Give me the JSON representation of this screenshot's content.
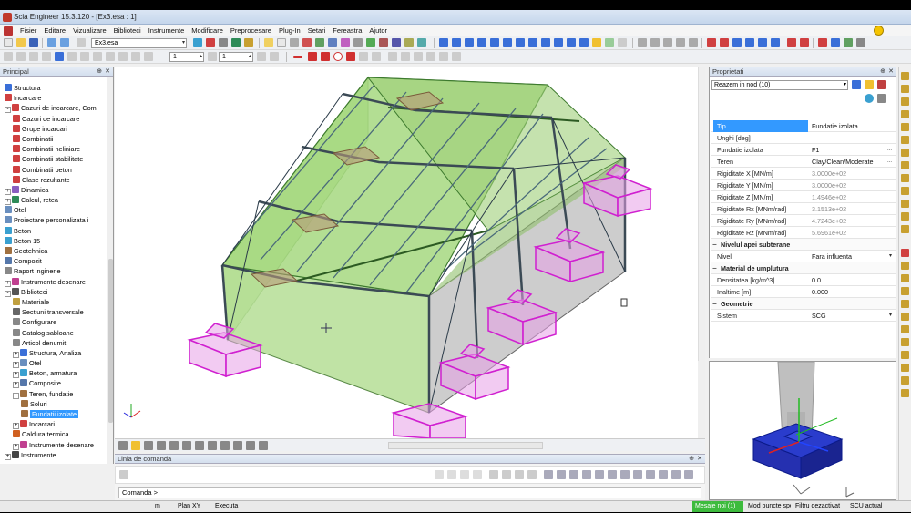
{
  "window": {
    "title": "Scia Engineer 15.3.120 - [Ex3.esa : 1]"
  },
  "menu": [
    "Fisier",
    "Editare",
    "Vizualizare",
    "Biblioteci",
    "Instrumente",
    "Modificare",
    "Preprocesare",
    "Plug-In",
    "Setari",
    "Fereastra",
    "Ajutor"
  ],
  "toolbar": {
    "project_combo": "Ex3.esa",
    "spin1": "1",
    "spin2": "1"
  },
  "left_panel": {
    "title": "Principal",
    "items": [
      {
        "label": "Structura",
        "indent": 1,
        "color": "#3a6fd8"
      },
      {
        "label": "Incarcare",
        "indent": 1,
        "color": "#d04040"
      },
      {
        "label": "Cazuri de incarcare, Com",
        "indent": 1,
        "color": "#d04040",
        "exp": "-"
      },
      {
        "label": "Cazuri de incarcare",
        "indent": 2,
        "color": "#d04040"
      },
      {
        "label": "Grupe incarcari",
        "indent": 2,
        "color": "#d04040"
      },
      {
        "label": "Combinatii",
        "indent": 2,
        "color": "#d04040"
      },
      {
        "label": "Combinatii neliniare",
        "indent": 2,
        "color": "#d04040"
      },
      {
        "label": "Combinatii stabilitate",
        "indent": 2,
        "color": "#d04040"
      },
      {
        "label": "Combinatii beton",
        "indent": 2,
        "color": "#d04040"
      },
      {
        "label": "Clase rezultante",
        "indent": 2,
        "color": "#d04040"
      },
      {
        "label": "Dinamica",
        "indent": 1,
        "color": "#8a5fc0",
        "exp": "+"
      },
      {
        "label": "Calcul, retea",
        "indent": 1,
        "color": "#2e8b57",
        "exp": "+"
      },
      {
        "label": "Otel",
        "indent": 1,
        "color": "#6a8fbf"
      },
      {
        "label": "Proiectare personalizata i",
        "indent": 1,
        "color": "#6a8fbf"
      },
      {
        "label": "Beton",
        "indent": 1,
        "color": "#3aa0d0"
      },
      {
        "label": "Beton 15",
        "indent": 1,
        "color": "#3aa0d0"
      },
      {
        "label": "Geotehnica",
        "indent": 1,
        "color": "#a07040"
      },
      {
        "label": "Compozit",
        "indent": 1,
        "color": "#5577aa"
      },
      {
        "label": "Raport inginerie",
        "indent": 1,
        "color": "#888888"
      },
      {
        "label": "Instrumente desenare",
        "indent": 1,
        "color": "#c04090",
        "exp": "+"
      },
      {
        "label": "Biblioteci",
        "indent": 1,
        "color": "#555555",
        "exp": "-"
      },
      {
        "label": "Materiale",
        "indent": 2,
        "color": "#c0a040"
      },
      {
        "label": "Sectiuni transversale",
        "indent": 2,
        "color": "#666666"
      },
      {
        "label": "Configurare",
        "indent": 2,
        "color": "#888888"
      },
      {
        "label": "Catalog sabloane",
        "indent": 2,
        "color": "#888888"
      },
      {
        "label": "Articol denumit",
        "indent": 2,
        "color": "#888888"
      },
      {
        "label": "Structura, Analiza",
        "indent": 2,
        "color": "#3a6fd8",
        "exp": "+"
      },
      {
        "label": "Otel",
        "indent": 2,
        "color": "#6a8fbf",
        "exp": "+"
      },
      {
        "label": "Beton, armatura",
        "indent": 2,
        "color": "#3aa0d0",
        "exp": "+"
      },
      {
        "label": "Composite",
        "indent": 2,
        "color": "#5577aa",
        "exp": "+"
      },
      {
        "label": "Teren, fundatie",
        "indent": 2,
        "color": "#a07040",
        "exp": "-"
      },
      {
        "label": "Soluri",
        "indent": 3,
        "color": "#a07040"
      },
      {
        "label": "Fundatii izolate",
        "indent": 3,
        "color": "#a07040",
        "selected": true
      },
      {
        "label": "Incarcari",
        "indent": 2,
        "color": "#d04040",
        "exp": "+"
      },
      {
        "label": "Caldura termica",
        "indent": 2,
        "color": "#d06020"
      },
      {
        "label": "Instrumente desenare",
        "indent": 2,
        "color": "#c04090",
        "exp": "+"
      },
      {
        "label": "Instrumente",
        "indent": 1,
        "color": "#444444",
        "exp": "+"
      }
    ]
  },
  "command_panel": {
    "title": "Linia de comanda",
    "prompt": "Comanda >"
  },
  "properties": {
    "title": "Proprietati",
    "selector": "Reazem in nod (10)",
    "rows": [
      {
        "k": "Tip",
        "v": "Fundatie izolata",
        "selected": true
      },
      {
        "k": "Unghi [deg]",
        "v": ""
      },
      {
        "k": "Fundatie izolata",
        "v": "F1",
        "dd": "..."
      },
      {
        "k": "Teren",
        "v": "Clay/Clean/Moderate",
        "dd": "..."
      },
      {
        "k": "Rigiditate X [MN/m]",
        "v": "3.0000e+02",
        "gray": true
      },
      {
        "k": "Rigiditate Y [MN/m]",
        "v": "3.0000e+02",
        "gray": true
      },
      {
        "k": "Rigiditate Z [MN/m]",
        "v": "1.4946e+02",
        "gray": true
      },
      {
        "k": "Rigiditate Rx [MNm/rad]",
        "v": "3.1513e+02",
        "gray": true
      },
      {
        "k": "Rigiditate Ry [MNm/rad]",
        "v": "4.7243e+02",
        "gray": true
      },
      {
        "k": "Rigiditate Rz [MNm/rad]",
        "v": "5.6961e+02",
        "gray": true
      },
      {
        "k": "Nivelul apei subterane",
        "section": true
      },
      {
        "k": "Nivel",
        "v": "Fara influenta",
        "dd": "▾"
      },
      {
        "k": "Material de umplutura",
        "section": true
      },
      {
        "k": "Densitatea [kg/m^3]",
        "v": "0.0"
      },
      {
        "k": "Inaltime [m]",
        "v": "0.000"
      },
      {
        "k": "Geometrie",
        "section": true
      },
      {
        "k": "Sistem",
        "v": "SCG",
        "dd": "▾"
      }
    ]
  },
  "status": {
    "units": "m",
    "plane": "Plan XY",
    "action": "Executa",
    "msg": "Mesaje noi (1)",
    "snap": "Mod puncte spe",
    "filter": "Filtru dezactivat",
    "ucs": "SCU actual"
  },
  "colors": {
    "accent": "#3399ff",
    "green_status": "#3dbb3d",
    "magenta": "#e040e0",
    "roof_green": "#9fd07a"
  }
}
